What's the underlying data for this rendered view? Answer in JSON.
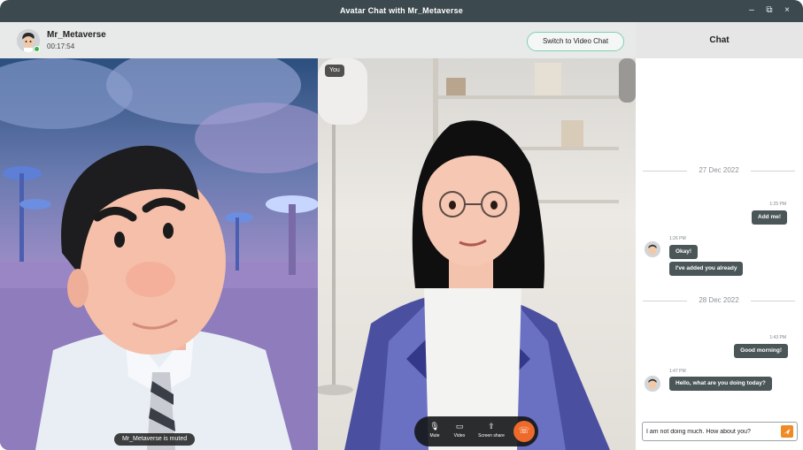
{
  "window": {
    "title": "Avatar Chat with Mr_Metaverse",
    "controls": {
      "minimize": "–",
      "maximize": "⧉",
      "close": "×"
    }
  },
  "header": {
    "contact_name": "Mr_Metaverse",
    "call_timer": "00:17:54",
    "status_color": "#3bb54a",
    "switch_button_label": "Switch to Video Chat"
  },
  "video": {
    "remote_muted_label": "Mr_Metaverse is muted",
    "local_label": "You",
    "controls": [
      {
        "icon": "microphone-icon",
        "glyph": "🎙",
        "label": "Mute"
      },
      {
        "icon": "video-camera-icon",
        "glyph": "▭",
        "label": "Video"
      },
      {
        "icon": "screen-share-icon",
        "glyph": "⇪",
        "label": "Screen share"
      }
    ],
    "end_call_icon": "end-call-icon",
    "end_call_glyph": "☏",
    "end_call_color": "#ee6a2a"
  },
  "chat": {
    "title": "Chat",
    "date_1": "27 Dec 2022",
    "date_2": "28 Dec 2022",
    "messages": [
      {
        "side": "out",
        "time": "1:25 PM",
        "text": "Add me!"
      },
      {
        "side": "in",
        "time": "1:26 PM",
        "text": "Okay!"
      },
      {
        "side": "in",
        "time": "",
        "text": "I've added you already"
      },
      {
        "side": "out",
        "time": "1:43 PM",
        "text": "Good morning!"
      },
      {
        "side": "in",
        "time": "1:47 PM",
        "text": "Hello, what are you doing today?"
      }
    ],
    "input_value": "I am not doing much. How about you?",
    "send_icon": "send-icon",
    "send_color": "#f08a24"
  }
}
